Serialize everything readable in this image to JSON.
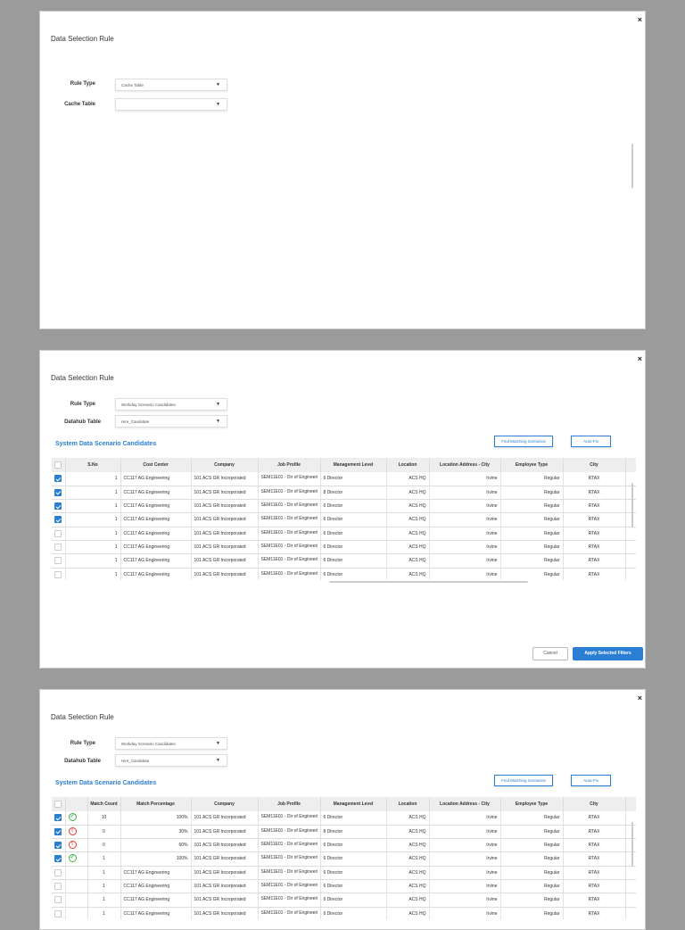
{
  "panel1": {
    "title": "Data Selection Rule",
    "close": "×",
    "rule_type_label": "Rule Type",
    "rule_type_value": "Cache Table",
    "cache_table_label": "Cache Table",
    "cache_table_value": "",
    "caret": "▼"
  },
  "panel2": {
    "title": "Data Selection Rule",
    "close": "×",
    "rule_type_label": "Rule Type",
    "rule_type_value": "Workday Scenario Candidates",
    "datahub_label": "Datahub Table",
    "datahub_value": "Hire_Candidate",
    "caret": "▼",
    "section": "System Data Scenario Candidates",
    "find_btn": "Find Matching Scenarios",
    "autofix_btn": "Auto-Fix",
    "cancel_btn": "Cancel",
    "apply_btn": "Apply Selected Filters",
    "columns": [
      "",
      "S.No",
      "Cost Center",
      "Company",
      "Job Profile",
      "Management Level",
      "Location",
      "Location Address - City",
      "Employee Type",
      "City"
    ],
    "rows": [
      {
        "checked": true,
        "sno": "1",
        "cost_center": "CC117 AG Engineering",
        "company": "101 ACS GR Incorporated",
        "job_profile": "SEM11E01 - Dir of Engineering",
        "mgmt": "6 Director",
        "location": "ACS HQ",
        "addr_city": "Irvine",
        "emp_type": "Regular",
        "city": "RTAX"
      },
      {
        "checked": true,
        "sno": "1",
        "cost_center": "CC117 AG Engineering",
        "company": "101 ACS GR Incorporated",
        "job_profile": "SEM11E01 - Dir of Engineering",
        "mgmt": "8 Director",
        "location": "ACS HQ",
        "addr_city": "Irvine",
        "emp_type": "Regular",
        "city": "RTAX"
      },
      {
        "checked": true,
        "sno": "1",
        "cost_center": "CC117 AG Engineering",
        "company": "101 ACS GR Incorporated",
        "job_profile": "SEM11E01 - Dir of Engineering",
        "mgmt": "6 Director",
        "location": "ACS HQ",
        "addr_city": "Irvine",
        "emp_type": "Regular",
        "city": "RTAX"
      },
      {
        "checked": true,
        "sno": "1",
        "cost_center": "CC117 AG Engineering",
        "company": "101 ACS GR Incorporated",
        "job_profile": "SEM11E01 - Dir of Engineering",
        "mgmt": "6 Director",
        "location": "ACS HQ",
        "addr_city": "Irvine",
        "emp_type": "Regular",
        "city": "RTAX"
      },
      {
        "checked": false,
        "sno": "1",
        "cost_center": "CC117 AG Engineering",
        "company": "101 ACS GR Incorporated",
        "job_profile": "SEM11E01 - Dir of Engineering",
        "mgmt": "6 Director",
        "location": "ACS HQ",
        "addr_city": "Irvine",
        "emp_type": "Regular",
        "city": "RTAX"
      },
      {
        "checked": false,
        "sno": "1",
        "cost_center": "CC117 AG Engineering",
        "company": "101 ACS GR Incorporated",
        "job_profile": "SEM11E01 - Dir of Engineering",
        "mgmt": "6 Director",
        "location": "ACS HQ",
        "addr_city": "Irvine",
        "emp_type": "Regular",
        "city": "RTAX"
      },
      {
        "checked": false,
        "sno": "1",
        "cost_center": "CC117 AG Engineering",
        "company": "101 ACS GR Incorporated",
        "job_profile": "SEM11E01 - Dir of Engineering",
        "mgmt": "6 Director",
        "location": "ACS HQ",
        "addr_city": "Irvine",
        "emp_type": "Regular",
        "city": "RTAX"
      },
      {
        "checked": false,
        "sno": "1",
        "cost_center": "CC117 AG Engineering",
        "company": "101 ACS GR Incorporated",
        "job_profile": "SEM11E01 - Dir of Engineering",
        "mgmt": "6 Director",
        "location": "ACS HQ",
        "addr_city": "Irvine",
        "emp_type": "Regular",
        "city": "RTAX"
      }
    ]
  },
  "panel3": {
    "title": "Data Selection Rule",
    "close": "×",
    "rule_type_label": "Rule Type",
    "rule_type_value": "Workday Scenario Candidates",
    "datahub_label": "Datahub Table",
    "datahub_value": "Hire_Candidate",
    "caret": "▼",
    "section": "System Data Scenario Candidates",
    "find_btn": "Find Matching Scenarios",
    "autofix_btn": "Auto-Fix",
    "columns": [
      "",
      "",
      "Match Count",
      "Match Percentage",
      "Company",
      "Job Profile",
      "Management Level",
      "Location",
      "Location Address - City",
      "Employee Type",
      "City"
    ],
    "rows": [
      {
        "checked": true,
        "status": "ok",
        "count": "10",
        "pct": "100%",
        "company": "101 ACS GR Incorporated",
        "job_profile": "SEM11E01 - Dir of Engineering",
        "mgmt": "6 Director",
        "location": "ACS HQ",
        "addr_city": "Irvine",
        "emp_type": "Regular",
        "city": "RTAX"
      },
      {
        "checked": true,
        "status": "err",
        "count": "0",
        "pct": "30%",
        "company": "101 ACS GR Incorporated",
        "job_profile": "SEM11E01 - Dir of Engineering",
        "mgmt": "8 Director",
        "location": "ACS HQ",
        "addr_city": "Irvine",
        "emp_type": "Regular",
        "city": "RTAX"
      },
      {
        "checked": true,
        "status": "err",
        "count": "0",
        "pct": "60%",
        "company": "101 ACS GR Incorporated",
        "job_profile": "SEM11E01 - Dir of Engineering",
        "mgmt": "6 Director",
        "location": "ACS HQ",
        "addr_city": "Irvine",
        "emp_type": "Regular",
        "city": "RTAX"
      },
      {
        "checked": true,
        "status": "ok",
        "count": "1",
        "pct": "100%",
        "company": "101 ACS GR Incorporated",
        "job_profile": "SEM11E01 - Dir of Engineering",
        "mgmt": "6 Director",
        "location": "ACS HQ",
        "addr_city": "Irvine",
        "emp_type": "Regular",
        "city": "RTAX"
      },
      {
        "checked": false,
        "status": "",
        "count": "1",
        "pct": "CC117 AG Engineering",
        "company": "101 ACS GR Incorporated",
        "job_profile": "SEM11E01 - Dir of Engineering",
        "mgmt": "6 Director",
        "location": "ACS HQ",
        "addr_city": "Irvine",
        "emp_type": "Regular",
        "city": "RTAX"
      },
      {
        "checked": false,
        "status": "",
        "count": "1",
        "pct": "CC117 AG Engineering",
        "company": "101 ACS GR Incorporated",
        "job_profile": "SEM11E01 - Dir of Engineering",
        "mgmt": "6 Director",
        "location": "ACS HQ",
        "addr_city": "Irvine",
        "emp_type": "Regular",
        "city": "RTAX"
      },
      {
        "checked": false,
        "status": "",
        "count": "1",
        "pct": "CC117 AG Engineering",
        "company": "101 ACS GR Incorporated",
        "job_profile": "SEM11E01 - Dir of Engineering",
        "mgmt": "6 Director",
        "location": "ACS HQ",
        "addr_city": "Irvine",
        "emp_type": "Regular",
        "city": "RTAX"
      },
      {
        "checked": false,
        "status": "",
        "count": "1",
        "pct": "CC117 AG Engineering",
        "company": "101 ACS GR Incorporated",
        "job_profile": "SEM11E01 - Dir of Engineering",
        "mgmt": "6 Director",
        "location": "ACS HQ",
        "addr_city": "Irvine",
        "emp_type": "Regular",
        "city": "RTAX"
      }
    ]
  },
  "colors": {
    "accent": "#2a7fd4",
    "ok": "#3cb043",
    "error": "#e53935",
    "backdrop": "#9b9b9b"
  }
}
